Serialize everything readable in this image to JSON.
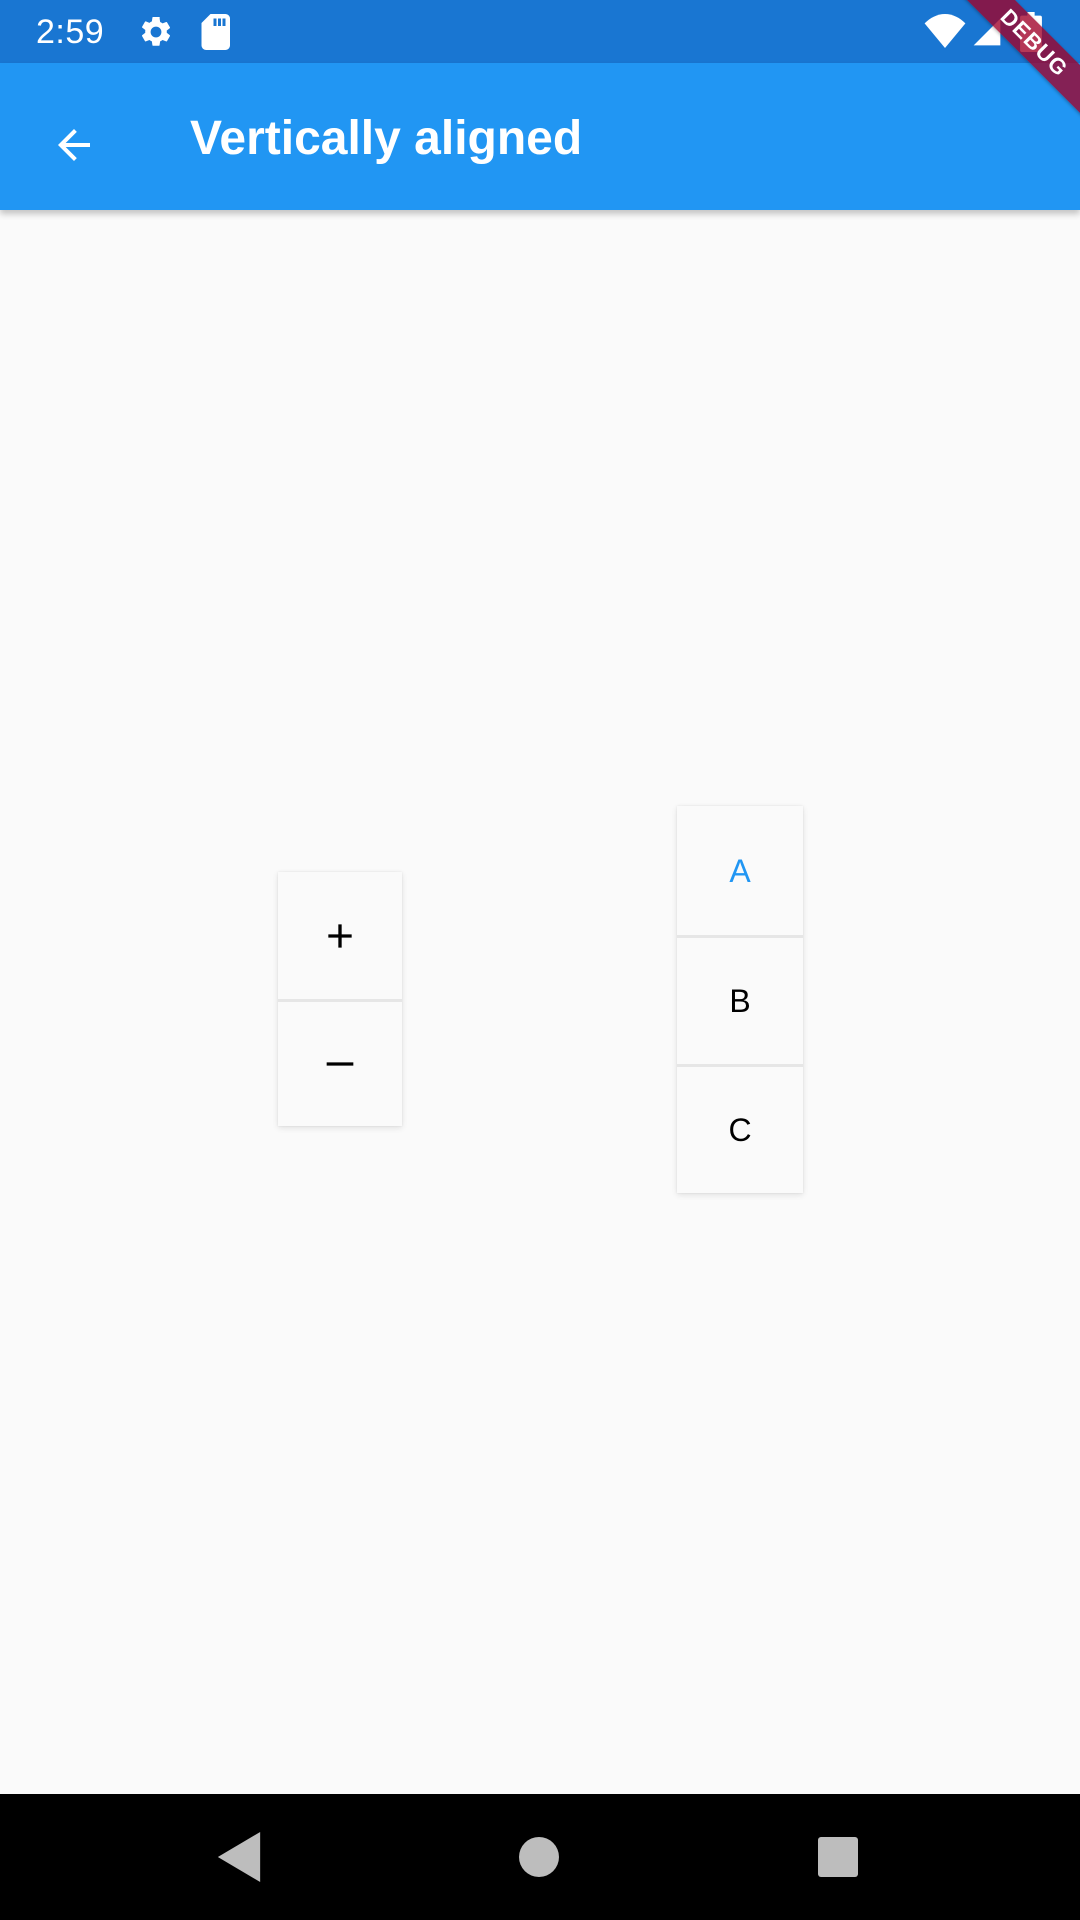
{
  "status_bar": {
    "time": "2:59",
    "icons": [
      "gear-icon",
      "sd-card-icon",
      "wifi-icon",
      "signal-icon",
      "battery-icon"
    ]
  },
  "app_bar": {
    "title": "Vertically aligned",
    "back_icon": "arrow-back-icon",
    "color": "#2196F3"
  },
  "debug_banner": {
    "label": "DEBUG"
  },
  "toggle_groups": {
    "icon_group": {
      "buttons": [
        {
          "icon": "plus-icon"
        },
        {
          "icon": "minus-icon"
        }
      ]
    },
    "letter_group": {
      "buttons": [
        {
          "label": "A",
          "selected": true
        },
        {
          "label": "B",
          "selected": false
        },
        {
          "label": "C",
          "selected": false
        }
      ]
    }
  },
  "nav_bar": {
    "buttons": [
      "back-triangle-icon",
      "home-circle-icon",
      "recents-square-icon"
    ]
  },
  "colors": {
    "status_bar": "#1976D2",
    "app_bar": "#2196F3",
    "selected_text": "#2196F3",
    "background": "#fafafa"
  }
}
